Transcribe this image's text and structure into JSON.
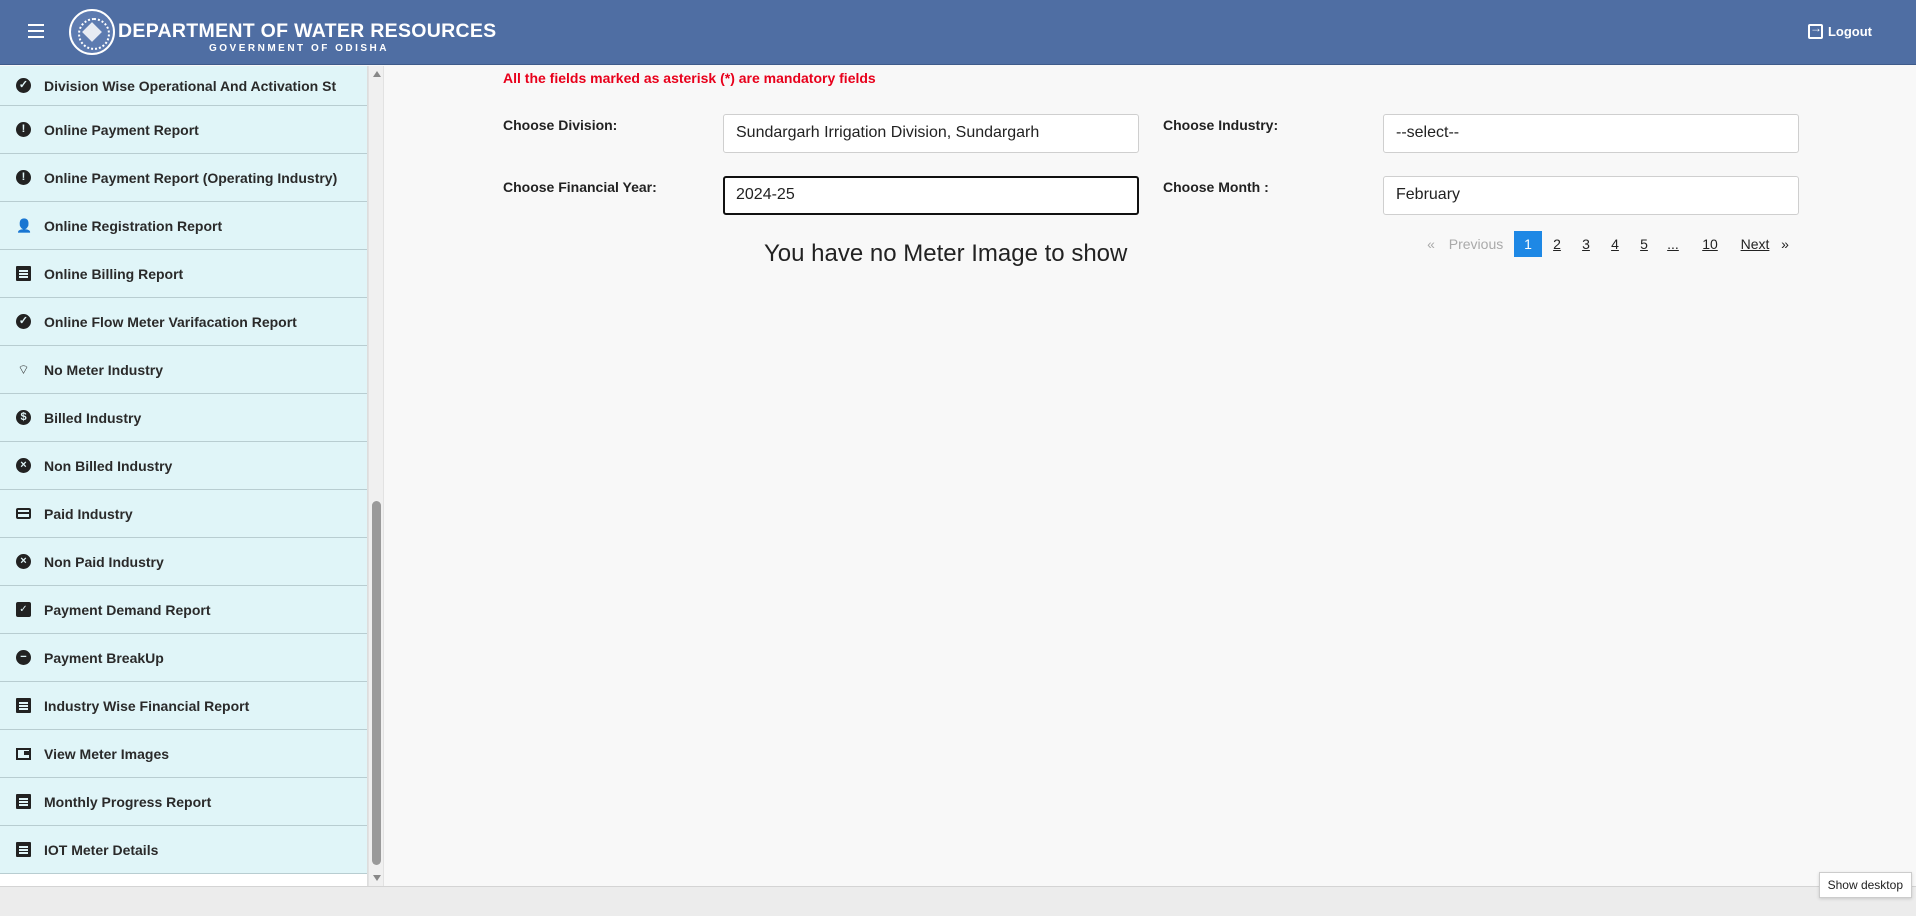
{
  "header": {
    "title": "DEPARTMENT OF WATER RESOURCES",
    "subtitle": "GOVERNMENT OF ODISHA",
    "logout_label": "Logout"
  },
  "sidebar": {
    "items": [
      {
        "label": "Division Wise Operational And Activation St",
        "icon": "check-circle-icon"
      },
      {
        "label": "Online Payment Report",
        "icon": "alert-circle-icon"
      },
      {
        "label": "Online Payment Report (Operating Industry)",
        "icon": "alert-circle-icon"
      },
      {
        "label": "Online Registration Report",
        "icon": "person-add-icon"
      },
      {
        "label": "Online Billing Report",
        "icon": "list-icon"
      },
      {
        "label": "Online Flow Meter Varifacation Report",
        "icon": "check-circle-icon"
      },
      {
        "label": "No Meter Industry",
        "icon": "wifi-tower-icon"
      },
      {
        "label": "Billed Industry",
        "icon": "dollar-circle-icon"
      },
      {
        "label": "Non Billed Industry",
        "icon": "cancel-circle-icon"
      },
      {
        "label": "Paid Industry",
        "icon": "credit-card-icon"
      },
      {
        "label": "Non Paid Industry",
        "icon": "cancel-circle-icon"
      },
      {
        "label": "Payment Demand Report",
        "icon": "check-box-icon"
      },
      {
        "label": "Payment BreakUp",
        "icon": "minus-circle-icon"
      },
      {
        "label": "Industry Wise Financial Report",
        "icon": "document-icon"
      },
      {
        "label": "View Meter Images",
        "icon": "picture-in-picture-icon"
      },
      {
        "label": "Monthly Progress Report",
        "icon": "list-icon"
      },
      {
        "label": "IOT Meter Details",
        "icon": "list-icon"
      }
    ]
  },
  "main": {
    "mandatory_note": "All the fields marked as asterisk (*) are mandatory fields",
    "division_label": "Choose Division:",
    "division_value": "Sundargarh Irrigation Division, Sundargarh",
    "industry_label": "Choose Industry:",
    "industry_value": "--select--",
    "fy_label": "Choose Financial Year:",
    "fy_value": "2024-25",
    "month_label": "Choose Month :",
    "month_value": "February",
    "empty_message": "You have no Meter Image to show"
  },
  "pagination": {
    "prev_arrow": "«",
    "previous": "Previous",
    "pages": [
      "1",
      "2",
      "3",
      "4",
      "5",
      "...",
      "10"
    ],
    "active_page": "1",
    "next": "Next",
    "next_arrow": "»"
  },
  "taskbar": {
    "tooltip": "Show desktop"
  },
  "colors": {
    "header_bg": "#4f6ea3",
    "sidebar_item_bg": "#e0f5f8",
    "mandatory_text": "#e8001b",
    "active_page": "#1e88e5"
  }
}
